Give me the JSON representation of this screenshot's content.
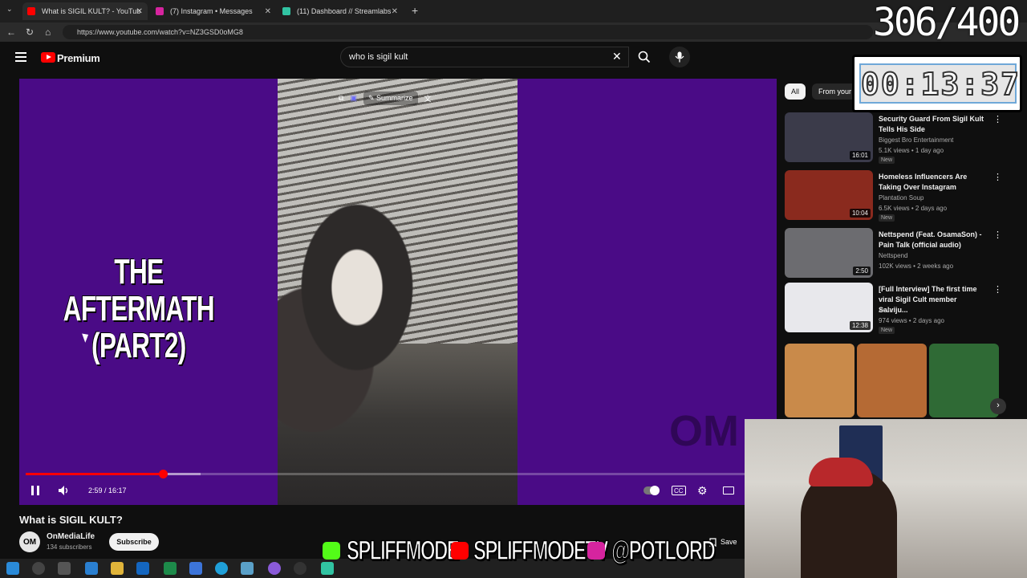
{
  "browser": {
    "tabs": [
      {
        "title": "What is SIGIL KULT? - YouTub",
        "favicon_color": "#ff0000"
      },
      {
        "title": "(7) Instagram • Messages",
        "favicon_color": "#d6249f"
      },
      {
        "title": "(11) Dashboard // Streamlabs",
        "favicon_color": "#31c3a2"
      }
    ],
    "url": "https://www.youtube.com/watch?v=NZ3GSD0oMG8"
  },
  "header": {
    "brand": "Premium",
    "search_value": "who is sigil kult"
  },
  "player": {
    "overlay_title": "THE AFTERMATH (PART2)",
    "summarize_label": "Summarize",
    "time": "2:59 / 16:17",
    "progress": 0.184,
    "buffered": 0.235,
    "watermark": "OM"
  },
  "video": {
    "title": "What is SIGIL KULT?",
    "channel": "OnMediaLife",
    "subscribers": "134 subscribers",
    "subscribe_label": "Subscribe",
    "save_label": "Save",
    "avatar_text": "OM"
  },
  "sidebar": {
    "chips": [
      "All",
      "From your search"
    ],
    "recs": [
      {
        "title": "Security Guard From Sigil Kult Tells His Side",
        "channel": "Biggest Bro Entertainment",
        "meta": "5.1K views • 1 day ago",
        "badge": "New",
        "duration": "16:01",
        "thumb_color": "#3b3b4a"
      },
      {
        "title": "Homeless Influencers Are Taking Over Instagram",
        "channel": "Plantation Soup",
        "meta": "6.5K views • 2 days ago",
        "badge": "New",
        "duration": "10:04",
        "thumb_color": "#8a2a1e"
      },
      {
        "title": "Nettspend (Feat. OsamaSon) - Pain Talk (official audio)",
        "channel": "Nettspend",
        "meta": "102K views • 2 weeks ago",
        "badge": "",
        "duration": "2:50",
        "thumb_color": "#6c6c70"
      },
      {
        "title": "[Full Interview] The first time viral Sigil Cult member Salviju...",
        "channel": "Avva",
        "meta": "974 views • 2 days ago",
        "badge": "New",
        "duration": "12:38",
        "thumb_color": "#e8e8ec"
      }
    ],
    "shorts_colors": [
      "#c98a4a",
      "#b56a34",
      "#2f6a35"
    ]
  },
  "overlays": {
    "counter": "306/400",
    "timer": "00:13:37",
    "banner_items": [
      {
        "text": "SPLIFFMODE",
        "icon": "kick-icon",
        "color": "#53fc18"
      },
      {
        "text": "SPLIFFMODETV",
        "icon": "youtube-icon",
        "color": "#ff0000"
      },
      {
        "text": "@POTLORD",
        "icon": "instagram-icon",
        "color": "#d6249f"
      }
    ]
  },
  "colors": {
    "player_bg": "#4a0b86",
    "accent": "#ff0000"
  }
}
